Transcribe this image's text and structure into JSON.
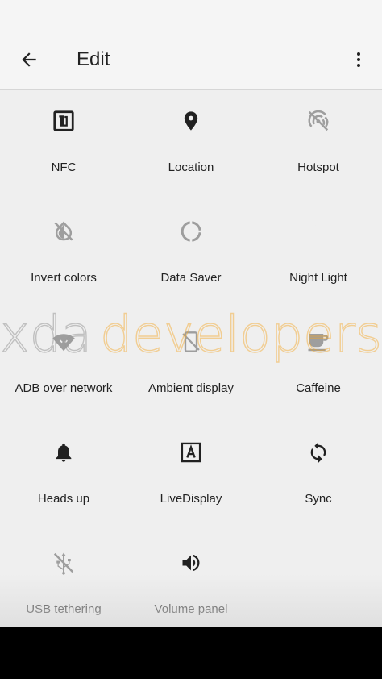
{
  "header": {
    "title": "Edit",
    "back_icon": "arrow-back-icon",
    "more_icon": "more-vert-icon"
  },
  "tiles": [
    {
      "label": "NFC",
      "icon": "nfc-icon",
      "state": "active"
    },
    {
      "label": "Location",
      "icon": "location-pin-icon",
      "state": "active"
    },
    {
      "label": "Hotspot",
      "icon": "hotspot-off-icon",
      "state": "inactive"
    },
    {
      "label": "Invert colors",
      "icon": "invert-colors-off-icon",
      "state": "inactive"
    },
    {
      "label": "Data Saver",
      "icon": "data-saver-icon",
      "state": "inactive"
    },
    {
      "label": "Night Light",
      "icon": "night-light-moon-icon",
      "state": "inactive"
    },
    {
      "label": "ADB over network",
      "icon": "wifi-adb-icon",
      "state": "inactive"
    },
    {
      "label": "Ambient display",
      "icon": "ambient-display-off-icon",
      "state": "inactive"
    },
    {
      "label": "Caffeine",
      "icon": "coffee-cup-icon",
      "state": "inactive"
    },
    {
      "label": "Heads up",
      "icon": "bell-icon",
      "state": "active"
    },
    {
      "label": "LiveDisplay",
      "icon": "live-display-icon",
      "state": "active"
    },
    {
      "label": "Sync",
      "icon": "sync-icon",
      "state": "active"
    },
    {
      "label": "USB tethering",
      "icon": "usb-off-icon",
      "state": "inactive"
    },
    {
      "label": "Volume panel",
      "icon": "volume-icon",
      "state": "active"
    }
  ],
  "watermark": {
    "part1": "xda",
    "part2": "developers"
  },
  "colors": {
    "active_icon": "#212121",
    "inactive_icon": "#9e9e9e",
    "background": "#efefef",
    "appbar": "#f5f5f5",
    "watermark_accent": "#f5a623"
  }
}
